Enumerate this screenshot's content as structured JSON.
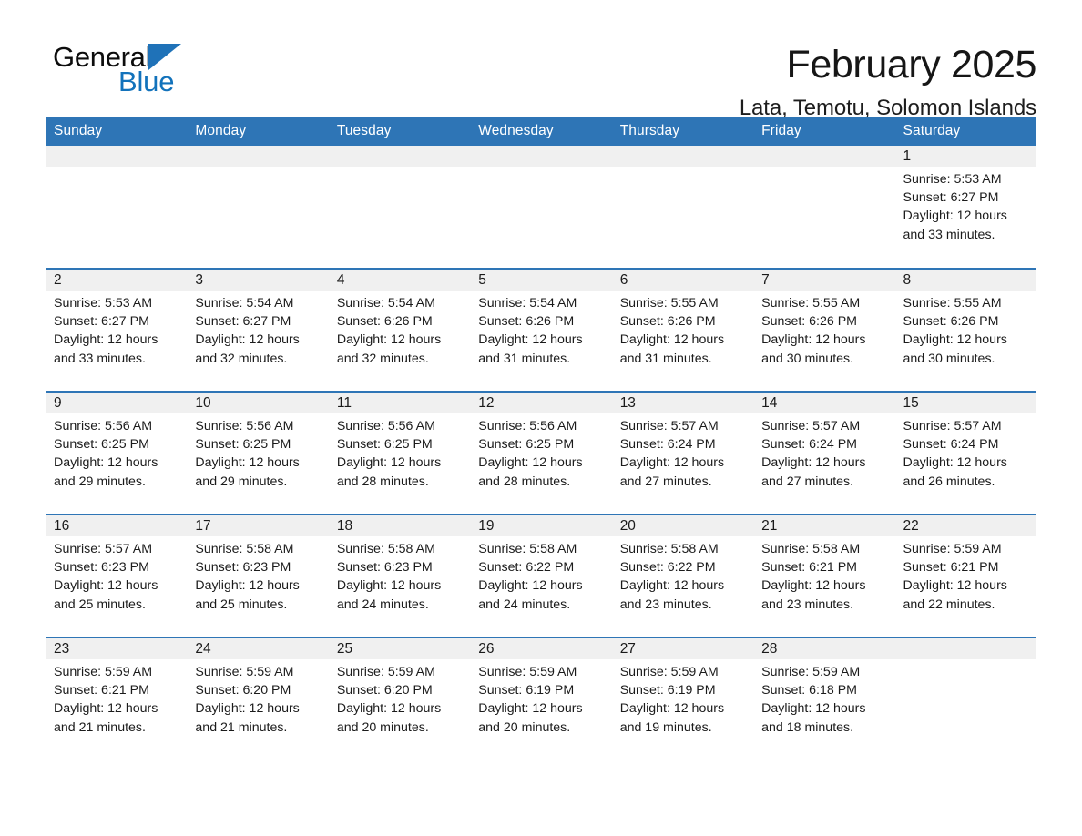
{
  "brand": {
    "name_part1": "General",
    "name_part2": "Blue",
    "triangle_color": "#1f72b8"
  },
  "header": {
    "title": "February 2025",
    "subtitle": "Lata, Temotu, Solomon Islands"
  },
  "theme": {
    "header_blue": "#2e75b6",
    "daynum_band": "#f0f0f0",
    "text": "#1a1a1a"
  },
  "calendar": {
    "weekday_headers": [
      "Sunday",
      "Monday",
      "Tuesday",
      "Wednesday",
      "Thursday",
      "Friday",
      "Saturday"
    ],
    "weeks": [
      [
        {
          "day": "",
          "sunrise": "",
          "sunset": "",
          "daylight": ""
        },
        {
          "day": "",
          "sunrise": "",
          "sunset": "",
          "daylight": ""
        },
        {
          "day": "",
          "sunrise": "",
          "sunset": "",
          "daylight": ""
        },
        {
          "day": "",
          "sunrise": "",
          "sunset": "",
          "daylight": ""
        },
        {
          "day": "",
          "sunrise": "",
          "sunset": "",
          "daylight": ""
        },
        {
          "day": "",
          "sunrise": "",
          "sunset": "",
          "daylight": ""
        },
        {
          "day": "1",
          "sunrise": "Sunrise: 5:53 AM",
          "sunset": "Sunset: 6:27 PM",
          "daylight": "Daylight: 12 hours and 33 minutes."
        }
      ],
      [
        {
          "day": "2",
          "sunrise": "Sunrise: 5:53 AM",
          "sunset": "Sunset: 6:27 PM",
          "daylight": "Daylight: 12 hours and 33 minutes."
        },
        {
          "day": "3",
          "sunrise": "Sunrise: 5:54 AM",
          "sunset": "Sunset: 6:27 PM",
          "daylight": "Daylight: 12 hours and 32 minutes."
        },
        {
          "day": "4",
          "sunrise": "Sunrise: 5:54 AM",
          "sunset": "Sunset: 6:26 PM",
          "daylight": "Daylight: 12 hours and 32 minutes."
        },
        {
          "day": "5",
          "sunrise": "Sunrise: 5:54 AM",
          "sunset": "Sunset: 6:26 PM",
          "daylight": "Daylight: 12 hours and 31 minutes."
        },
        {
          "day": "6",
          "sunrise": "Sunrise: 5:55 AM",
          "sunset": "Sunset: 6:26 PM",
          "daylight": "Daylight: 12 hours and 31 minutes."
        },
        {
          "day": "7",
          "sunrise": "Sunrise: 5:55 AM",
          "sunset": "Sunset: 6:26 PM",
          "daylight": "Daylight: 12 hours and 30 minutes."
        },
        {
          "day": "8",
          "sunrise": "Sunrise: 5:55 AM",
          "sunset": "Sunset: 6:26 PM",
          "daylight": "Daylight: 12 hours and 30 minutes."
        }
      ],
      [
        {
          "day": "9",
          "sunrise": "Sunrise: 5:56 AM",
          "sunset": "Sunset: 6:25 PM",
          "daylight": "Daylight: 12 hours and 29 minutes."
        },
        {
          "day": "10",
          "sunrise": "Sunrise: 5:56 AM",
          "sunset": "Sunset: 6:25 PM",
          "daylight": "Daylight: 12 hours and 29 minutes."
        },
        {
          "day": "11",
          "sunrise": "Sunrise: 5:56 AM",
          "sunset": "Sunset: 6:25 PM",
          "daylight": "Daylight: 12 hours and 28 minutes."
        },
        {
          "day": "12",
          "sunrise": "Sunrise: 5:56 AM",
          "sunset": "Sunset: 6:25 PM",
          "daylight": "Daylight: 12 hours and 28 minutes."
        },
        {
          "day": "13",
          "sunrise": "Sunrise: 5:57 AM",
          "sunset": "Sunset: 6:24 PM",
          "daylight": "Daylight: 12 hours and 27 minutes."
        },
        {
          "day": "14",
          "sunrise": "Sunrise: 5:57 AM",
          "sunset": "Sunset: 6:24 PM",
          "daylight": "Daylight: 12 hours and 27 minutes."
        },
        {
          "day": "15",
          "sunrise": "Sunrise: 5:57 AM",
          "sunset": "Sunset: 6:24 PM",
          "daylight": "Daylight: 12 hours and 26 minutes."
        }
      ],
      [
        {
          "day": "16",
          "sunrise": "Sunrise: 5:57 AM",
          "sunset": "Sunset: 6:23 PM",
          "daylight": "Daylight: 12 hours and 25 minutes."
        },
        {
          "day": "17",
          "sunrise": "Sunrise: 5:58 AM",
          "sunset": "Sunset: 6:23 PM",
          "daylight": "Daylight: 12 hours and 25 minutes."
        },
        {
          "day": "18",
          "sunrise": "Sunrise: 5:58 AM",
          "sunset": "Sunset: 6:23 PM",
          "daylight": "Daylight: 12 hours and 24 minutes."
        },
        {
          "day": "19",
          "sunrise": "Sunrise: 5:58 AM",
          "sunset": "Sunset: 6:22 PM",
          "daylight": "Daylight: 12 hours and 24 minutes."
        },
        {
          "day": "20",
          "sunrise": "Sunrise: 5:58 AM",
          "sunset": "Sunset: 6:22 PM",
          "daylight": "Daylight: 12 hours and 23 minutes."
        },
        {
          "day": "21",
          "sunrise": "Sunrise: 5:58 AM",
          "sunset": "Sunset: 6:21 PM",
          "daylight": "Daylight: 12 hours and 23 minutes."
        },
        {
          "day": "22",
          "sunrise": "Sunrise: 5:59 AM",
          "sunset": "Sunset: 6:21 PM",
          "daylight": "Daylight: 12 hours and 22 minutes."
        }
      ],
      [
        {
          "day": "23",
          "sunrise": "Sunrise: 5:59 AM",
          "sunset": "Sunset: 6:21 PM",
          "daylight": "Daylight: 12 hours and 21 minutes."
        },
        {
          "day": "24",
          "sunrise": "Sunrise: 5:59 AM",
          "sunset": "Sunset: 6:20 PM",
          "daylight": "Daylight: 12 hours and 21 minutes."
        },
        {
          "day": "25",
          "sunrise": "Sunrise: 5:59 AM",
          "sunset": "Sunset: 6:20 PM",
          "daylight": "Daylight: 12 hours and 20 minutes."
        },
        {
          "day": "26",
          "sunrise": "Sunrise: 5:59 AM",
          "sunset": "Sunset: 6:19 PM",
          "daylight": "Daylight: 12 hours and 20 minutes."
        },
        {
          "day": "27",
          "sunrise": "Sunrise: 5:59 AM",
          "sunset": "Sunset: 6:19 PM",
          "daylight": "Daylight: 12 hours and 19 minutes."
        },
        {
          "day": "28",
          "sunrise": "Sunrise: 5:59 AM",
          "sunset": "Sunset: 6:18 PM",
          "daylight": "Daylight: 12 hours and 18 minutes."
        },
        {
          "day": "",
          "sunrise": "",
          "sunset": "",
          "daylight": ""
        }
      ]
    ]
  }
}
